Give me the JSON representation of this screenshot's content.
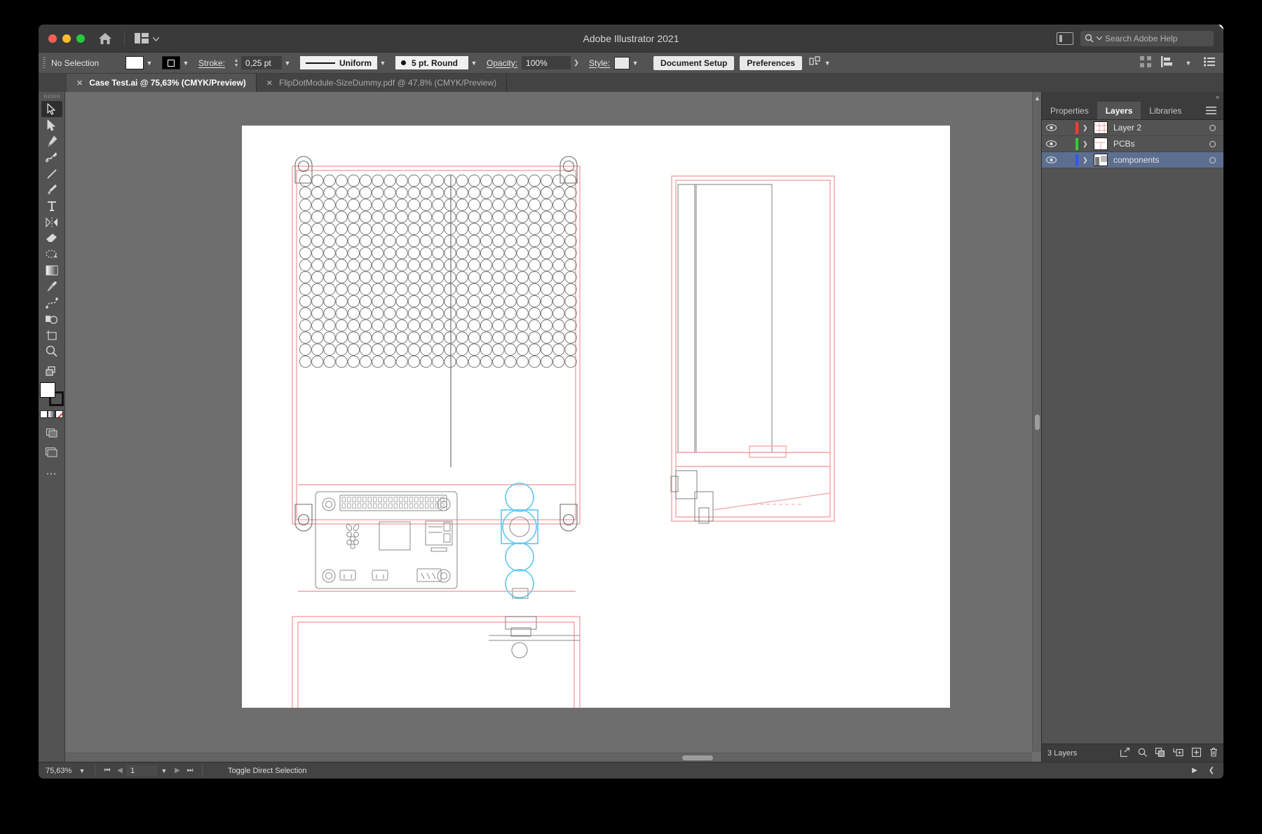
{
  "window": {
    "title": "Adobe Illustrator 2021",
    "traffic_lights": [
      "close",
      "minimize",
      "zoom"
    ],
    "home_icon": "home-icon",
    "arrange_icon": "arrange-documents-icon",
    "panel_toggle_icon": "panel-toggle-icon",
    "search": {
      "icon": "search-icon",
      "placeholder": "Search Adobe Help"
    }
  },
  "control_bar": {
    "selection_status": "No Selection",
    "fill_swatch_label": "fill-swatch",
    "stroke_swatch_label": "stroke-swatch",
    "stroke_label": "Stroke:",
    "stroke_weight": "0,25 pt",
    "stroke_profile": "Uniform",
    "brush_definition": "5 pt. Round",
    "opacity_label": "Opacity:",
    "opacity_value": "100%",
    "style_label": "Style:",
    "document_setup": "Document Setup",
    "preferences": "Preferences",
    "align_icon": "align-to-selection-icon",
    "right_icons": [
      "arrange-grid-icon",
      "align-icon",
      "options-list-icon"
    ]
  },
  "tabs": [
    {
      "title": "Case Test.ai @ 75,63% (CMYK/Preview)",
      "active": true
    },
    {
      "title": "FlipDotModule-SizeDummy.pdf @ 47,8% (CMYK/Preview)",
      "active": false
    }
  ],
  "toolbar": {
    "tools": [
      {
        "name": "selection-tool",
        "active": true
      },
      {
        "name": "direct-selection-tool",
        "active": false
      },
      {
        "name": "pen-tool",
        "active": false
      },
      {
        "name": "curvature-tool",
        "active": false
      },
      {
        "name": "line-segment-tool",
        "active": false
      },
      {
        "name": "paintbrush-tool",
        "active": false
      },
      {
        "name": "type-tool",
        "active": false
      },
      {
        "name": "reflect-tool",
        "active": false
      },
      {
        "name": "eraser-tool",
        "active": false
      },
      {
        "name": "shaper-tool",
        "active": false
      },
      {
        "name": "gradient-tool",
        "active": false
      },
      {
        "name": "eyedropper-tool",
        "active": false
      },
      {
        "name": "blend-tool",
        "active": false
      },
      {
        "name": "shape-builder-tool",
        "active": false
      },
      {
        "name": "artboard-tool",
        "active": false
      },
      {
        "name": "zoom-tool",
        "active": false
      },
      {
        "name": "group-selection-tool",
        "active": false
      }
    ],
    "fill_color": "#ffffff",
    "stroke_color": "#000000",
    "color_modes": [
      "color-swatch",
      "gradient-swatch",
      "none-swatch"
    ],
    "more_tools": "edit-toolbar-icon"
  },
  "panels": {
    "tabs": [
      {
        "label": "Properties",
        "active": false
      },
      {
        "label": "Layers",
        "active": true
      },
      {
        "label": "Libraries",
        "active": false
      }
    ],
    "menu_icon": "panel-menu-icon",
    "layers": [
      {
        "name": "Layer 2",
        "color": "#ff3b30",
        "visible": true,
        "selected": false
      },
      {
        "name": "PCBs",
        "color": "#33cc33",
        "visible": true,
        "selected": false
      },
      {
        "name": "components",
        "color": "#3355ee",
        "visible": true,
        "selected": true
      }
    ],
    "footer": {
      "count": "3 Layers",
      "icons": [
        "release-to-layers-icon",
        "locate-object-icon",
        "make-clipping-mask-icon",
        "create-new-sublayer-icon",
        "create-new-layer-icon",
        "delete-layer-icon"
      ]
    }
  },
  "status_bar": {
    "zoom": "75,63%",
    "first_page_icon": "first-page-icon",
    "prev_page_icon": "previous-page-icon",
    "page": "1",
    "next_page_icon": "next-page-icon",
    "last_page_icon": "last-page-icon",
    "status_text": "Toggle Direct Selection",
    "nav_icons": [
      "status-next-icon",
      "status-prev-icon"
    ]
  },
  "artwork": {
    "description": "Technical line drawing of a flip-dot display case: front view with dot matrix grid, Raspberry Pi board outline, side view, and bottom plate",
    "stroke_color": "#6b6b6b",
    "guide_color": "#f4a3a3",
    "highlight_color": "#5bc8f0",
    "dot_grid": {
      "columns": 23,
      "rows": 16,
      "dot_diameter": 16
    },
    "pi_board": {
      "label": "raspberry-pi-outline",
      "gpio_pins": 20
    }
  }
}
